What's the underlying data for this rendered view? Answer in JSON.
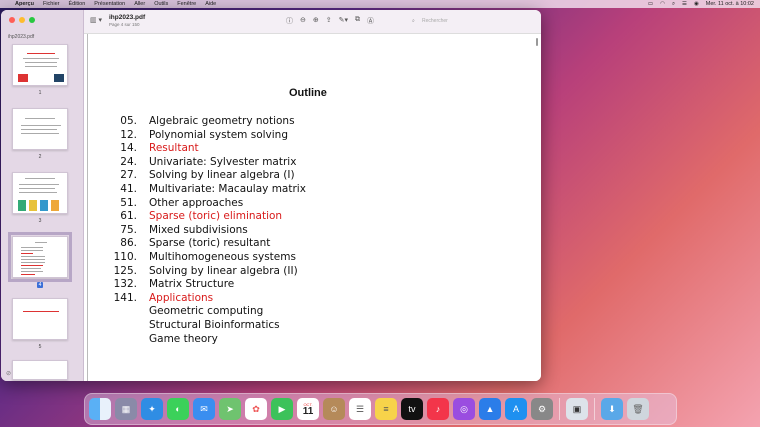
{
  "menubar": {
    "apple": "",
    "app": "Aperçu",
    "items": [
      "Fichier",
      "Édition",
      "Présentation",
      "Aller",
      "Outils",
      "Fenêtre",
      "Aide"
    ],
    "datetime": "Mer. 11 oct. à 10:02"
  },
  "sidebar": {
    "filename": "ihp2023.pdf",
    "pages": [
      "1",
      "2",
      "3",
      "4",
      "5"
    ],
    "selected_page": "4"
  },
  "toolbar": {
    "title": "ihp2023.pdf",
    "subtitle": "Page 4 sur 150",
    "search_placeholder": "Rechercher"
  },
  "document": {
    "title": "Outline",
    "toc": [
      {
        "num": "05.",
        "label": "Algebraic geometry notions",
        "red": false
      },
      {
        "num": "12.",
        "label": "Polynomial system solving",
        "red": false
      },
      {
        "num": "14.",
        "label": "Resultant",
        "red": true
      },
      {
        "num": "24.",
        "label": "Univariate:  Sylvester matrix",
        "red": false
      },
      {
        "num": "27.",
        "label": "Solving by linear algebra (I)",
        "red": false
      },
      {
        "num": "41.",
        "label": "Multivariate:  Macaulay matrix",
        "red": false
      },
      {
        "num": "51.",
        "label": "Other approaches",
        "red": false
      },
      {
        "num": "61.",
        "label": "Sparse (toric) elimination",
        "red": true
      },
      {
        "num": "75.",
        "label": "Mixed subdivisions",
        "red": false
      },
      {
        "num": "86.",
        "label": "Sparse (toric) resultant",
        "red": false
      },
      {
        "num": "110.",
        "label": "Multihomogeneous systems",
        "red": false
      },
      {
        "num": "125.",
        "label": "Solving by linear algebra (II)",
        "red": false
      },
      {
        "num": "132.",
        "label": "Matrix Structure",
        "red": false
      },
      {
        "num": "141.",
        "label": "Applications",
        "red": true
      },
      {
        "num": "",
        "label": "Geometric computing",
        "red": false
      },
      {
        "num": "",
        "label": "Structural Bioinformatics",
        "red": false
      },
      {
        "num": "",
        "label": "Game theory",
        "red": false
      }
    ]
  },
  "dock": {
    "calendar_month": "OCT.",
    "calendar_day": "11",
    "apps": [
      "finder-icon",
      "launchpad-icon",
      "safari-icon",
      "messages-icon",
      "mail-icon",
      "maps-icon",
      "photos-icon",
      "facetime-icon",
      "calendar-icon",
      "contacts-icon",
      "reminders-icon",
      "notes-icon",
      "appletv-icon",
      "music-icon",
      "podcasts-icon",
      "keynote-icon",
      "appstore-icon",
      "settings-icon",
      "preview-icon",
      "downloads-icon",
      "trash-icon"
    ]
  },
  "colors": {
    "accent_red": "#d81a1a",
    "selection_blue": "#3b6fd8"
  }
}
